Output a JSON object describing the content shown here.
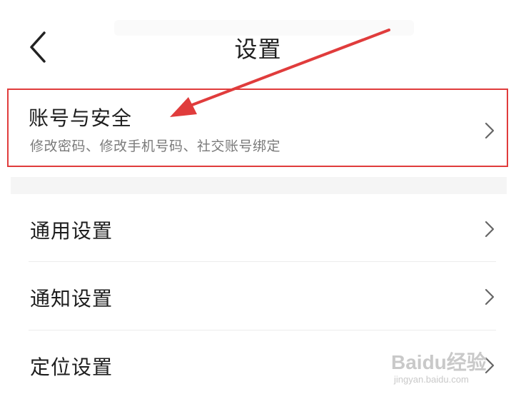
{
  "header": {
    "title": "设置",
    "back_icon": "chevron-left-icon"
  },
  "account_security": {
    "label": "账号与安全",
    "description": "修改密码、修改手机号码、社交账号绑定",
    "highlight_color": "#e03c3c"
  },
  "settings_items": [
    {
      "label": "通用设置"
    },
    {
      "label": "通知设置"
    },
    {
      "label": "定位设置"
    }
  ],
  "annotation": {
    "arrow_color": "#e03c3c"
  },
  "watermark": {
    "brand": "Baidu经验",
    "url": "jingyan.baidu.com"
  }
}
